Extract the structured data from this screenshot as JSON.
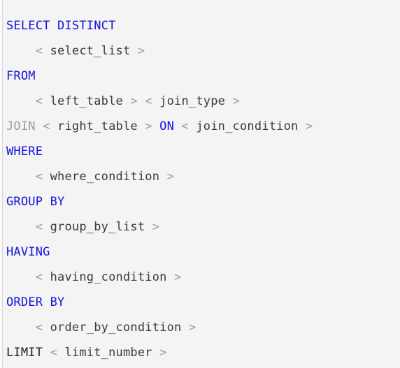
{
  "block": {
    "language": "sql",
    "background_color": "#f4f4f4",
    "rule_color": "#d7d7d7",
    "keyword_color": "#1414e0",
    "dim_keyword_color": "#9a9a9a",
    "dark_keyword_color": "#1b1b1b",
    "angle_color": "#9b9b9b",
    "identifier_color": "#3a3a3a"
  },
  "lines": [
    {
      "indent": "",
      "tokens": [
        {
          "text": "SELECT DISTINCT",
          "type": "kw"
        }
      ]
    },
    {
      "indent": "    ",
      "tokens": [
        {
          "text": "<",
          "type": "angle"
        },
        {
          "text": " ",
          "type": "plain"
        },
        {
          "text": "select_list",
          "type": "ident"
        },
        {
          "text": " ",
          "type": "plain"
        },
        {
          "text": ">",
          "type": "angle"
        }
      ]
    },
    {
      "indent": "",
      "tokens": [
        {
          "text": "FROM",
          "type": "kw"
        }
      ]
    },
    {
      "indent": "    ",
      "tokens": [
        {
          "text": "<",
          "type": "angle"
        },
        {
          "text": " ",
          "type": "plain"
        },
        {
          "text": "left_table",
          "type": "ident"
        },
        {
          "text": " ",
          "type": "plain"
        },
        {
          "text": ">",
          "type": "angle"
        },
        {
          "text": " ",
          "type": "plain"
        },
        {
          "text": "<",
          "type": "angle"
        },
        {
          "text": " ",
          "type": "plain"
        },
        {
          "text": "join_type",
          "type": "ident"
        },
        {
          "text": " ",
          "type": "plain"
        },
        {
          "text": ">",
          "type": "angle"
        }
      ]
    },
    {
      "indent": "",
      "tokens": [
        {
          "text": "JOIN",
          "type": "kw-dim"
        },
        {
          "text": " ",
          "type": "plain"
        },
        {
          "text": "<",
          "type": "angle"
        },
        {
          "text": " ",
          "type": "plain"
        },
        {
          "text": "right_table",
          "type": "ident"
        },
        {
          "text": " ",
          "type": "plain"
        },
        {
          "text": ">",
          "type": "angle"
        },
        {
          "text": " ",
          "type": "plain"
        },
        {
          "text": "ON",
          "type": "kw"
        },
        {
          "text": " ",
          "type": "plain"
        },
        {
          "text": "<",
          "type": "angle"
        },
        {
          "text": " ",
          "type": "plain"
        },
        {
          "text": "join_condition",
          "type": "ident"
        },
        {
          "text": " ",
          "type": "plain"
        },
        {
          "text": ">",
          "type": "angle"
        }
      ]
    },
    {
      "indent": "",
      "tokens": [
        {
          "text": "WHERE",
          "type": "kw"
        }
      ]
    },
    {
      "indent": "    ",
      "tokens": [
        {
          "text": "<",
          "type": "angle"
        },
        {
          "text": " ",
          "type": "plain"
        },
        {
          "text": "where_condition",
          "type": "ident"
        },
        {
          "text": " ",
          "type": "plain"
        },
        {
          "text": ">",
          "type": "angle"
        }
      ]
    },
    {
      "indent": "",
      "tokens": [
        {
          "text": "GROUP BY",
          "type": "kw"
        }
      ]
    },
    {
      "indent": "    ",
      "tokens": [
        {
          "text": "<",
          "type": "angle"
        },
        {
          "text": " ",
          "type": "plain"
        },
        {
          "text": "group_by_list",
          "type": "ident"
        },
        {
          "text": " ",
          "type": "plain"
        },
        {
          "text": ">",
          "type": "angle"
        }
      ]
    },
    {
      "indent": "",
      "tokens": [
        {
          "text": "HAVING",
          "type": "kw"
        }
      ]
    },
    {
      "indent": "    ",
      "tokens": [
        {
          "text": "<",
          "type": "angle"
        },
        {
          "text": " ",
          "type": "plain"
        },
        {
          "text": "having_condition",
          "type": "ident"
        },
        {
          "text": " ",
          "type": "plain"
        },
        {
          "text": ">",
          "type": "angle"
        }
      ]
    },
    {
      "indent": "",
      "tokens": [
        {
          "text": "ORDER BY",
          "type": "kw"
        }
      ]
    },
    {
      "indent": "    ",
      "tokens": [
        {
          "text": "<",
          "type": "angle"
        },
        {
          "text": " ",
          "type": "plain"
        },
        {
          "text": "order_by_condition",
          "type": "ident"
        },
        {
          "text": " ",
          "type": "plain"
        },
        {
          "text": ">",
          "type": "angle"
        }
      ]
    },
    {
      "indent": "",
      "tokens": [
        {
          "text": "LIMIT",
          "type": "kw-dark"
        },
        {
          "text": " ",
          "type": "plain"
        },
        {
          "text": "<",
          "type": "angle"
        },
        {
          "text": " ",
          "type": "plain"
        },
        {
          "text": "limit_number",
          "type": "ident"
        },
        {
          "text": " ",
          "type": "plain"
        },
        {
          "text": ">",
          "type": "angle"
        }
      ]
    }
  ]
}
